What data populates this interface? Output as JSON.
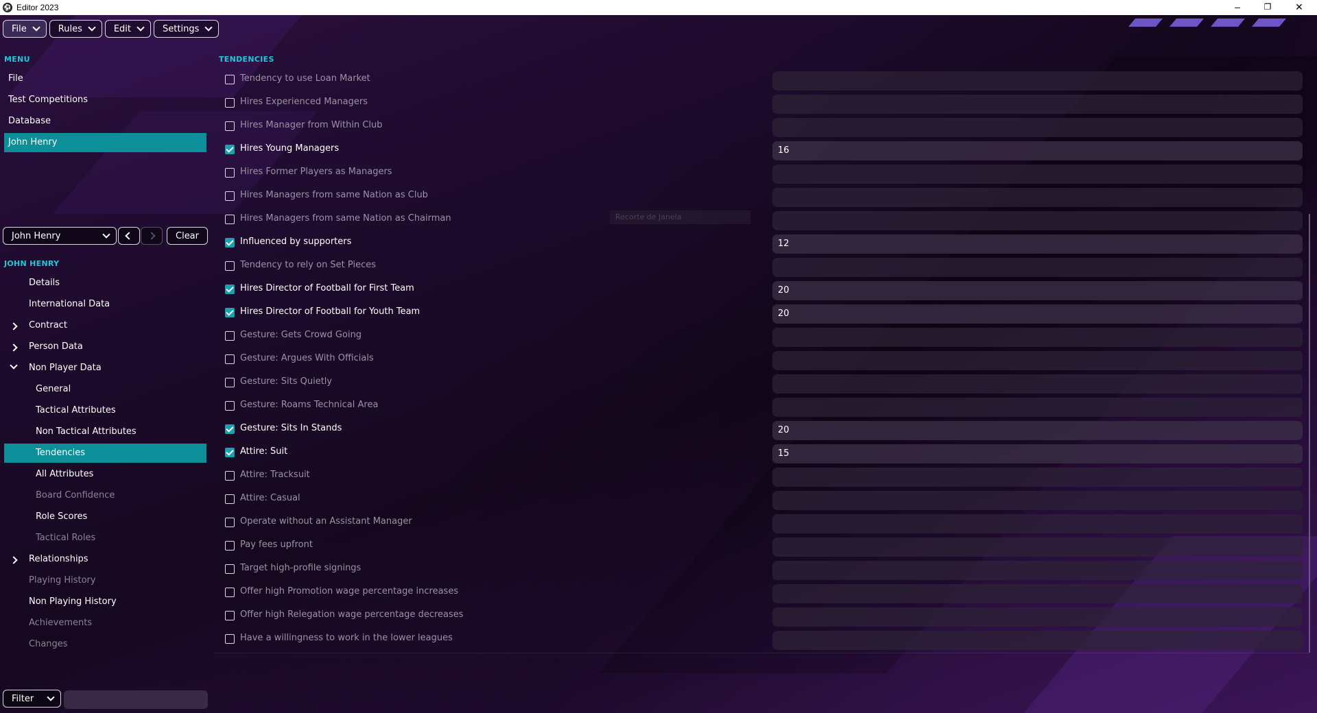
{
  "window": {
    "title": "Editor 2023"
  },
  "menubar": [
    {
      "label": "File"
    },
    {
      "label": "Rules"
    },
    {
      "label": "Edit"
    },
    {
      "label": "Settings"
    }
  ],
  "sidebar": {
    "menu_title": "MENU",
    "menu_items": [
      {
        "label": "File"
      },
      {
        "label": "Test Competitions"
      },
      {
        "label": "Database"
      },
      {
        "label": "John Henry"
      }
    ],
    "selector": {
      "value": "John Henry",
      "clear_label": "Clear"
    },
    "person_title": "JOHN HENRY",
    "tree": [
      {
        "label": "Details"
      },
      {
        "label": "International Data"
      },
      {
        "label": "Contract"
      },
      {
        "label": "Person Data"
      },
      {
        "label": "Non Player Data"
      },
      {
        "label": "General"
      },
      {
        "label": "Tactical Attributes"
      },
      {
        "label": "Non Tactical Attributes"
      },
      {
        "label": "Tendencies"
      },
      {
        "label": "All Attributes"
      },
      {
        "label": "Board Confidence"
      },
      {
        "label": "Role Scores"
      },
      {
        "label": "Tactical Roles"
      },
      {
        "label": "Relationships"
      },
      {
        "label": "Playing History"
      },
      {
        "label": "Non Playing History"
      },
      {
        "label": "Achievements"
      },
      {
        "label": "Changes"
      }
    ],
    "filter_label": "Filter"
  },
  "content": {
    "title": "TENDENCIES",
    "tooltip": "Recorte de Janela",
    "rows": [
      {
        "label": "Tendency to use Loan Market",
        "checked": false,
        "value": ""
      },
      {
        "label": "Hires Experienced Managers",
        "checked": false,
        "value": ""
      },
      {
        "label": "Hires Manager from Within Club",
        "checked": false,
        "value": ""
      },
      {
        "label": "Hires Young Managers",
        "checked": true,
        "value": "16"
      },
      {
        "label": "Hires Former Players as Managers",
        "checked": false,
        "value": ""
      },
      {
        "label": "Hires Managers from same Nation as Club",
        "checked": false,
        "value": ""
      },
      {
        "label": "Hires Managers from same Nation as Chairman",
        "checked": false,
        "value": ""
      },
      {
        "label": "Influenced by supporters",
        "checked": true,
        "value": "12"
      },
      {
        "label": "Tendency to rely on Set Pieces",
        "checked": false,
        "value": ""
      },
      {
        "label": "Hires Director of Football for First Team",
        "checked": true,
        "value": "20"
      },
      {
        "label": "Hires Director of Football for Youth Team",
        "checked": true,
        "value": "20"
      },
      {
        "label": "Gesture: Gets Crowd Going",
        "checked": false,
        "value": ""
      },
      {
        "label": "Gesture: Argues With Officials",
        "checked": false,
        "value": ""
      },
      {
        "label": "Gesture: Sits Quietly",
        "checked": false,
        "value": ""
      },
      {
        "label": "Gesture: Roams Technical Area",
        "checked": false,
        "value": ""
      },
      {
        "label": "Gesture: Sits In Stands",
        "checked": true,
        "value": "20"
      },
      {
        "label": "Attire: Suit",
        "checked": true,
        "value": "15"
      },
      {
        "label": "Attire: Tracksuit",
        "checked": false,
        "value": ""
      },
      {
        "label": "Attire: Casual",
        "checked": false,
        "value": ""
      },
      {
        "label": "Operate without an Assistant Manager",
        "checked": false,
        "value": ""
      },
      {
        "label": "Pay fees upfront",
        "checked": false,
        "value": ""
      },
      {
        "label": "Target high-profile signings",
        "checked": false,
        "value": ""
      },
      {
        "label": "Offer high Promotion wage percentage increases",
        "checked": false,
        "value": ""
      },
      {
        "label": "Offer high Relegation wage percentage decreases",
        "checked": false,
        "value": ""
      },
      {
        "label": "Have a willingness to work in the lower leagues",
        "checked": false,
        "value": ""
      }
    ]
  }
}
